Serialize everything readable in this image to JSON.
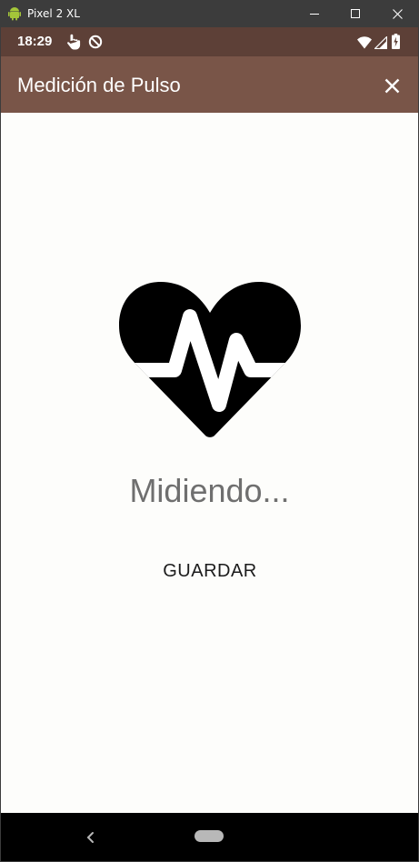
{
  "window": {
    "title": "Pixel 2 XL",
    "controls": [
      "minimize-icon",
      "maximize-icon",
      "close-icon"
    ]
  },
  "status_bar": {
    "time": "18:29",
    "left_icons": [
      "touch-icon",
      "do-not-disturb-icon"
    ],
    "right_icons": [
      "wifi-icon",
      "signal-icon",
      "battery-icon"
    ],
    "color": "#5d4037"
  },
  "app_bar": {
    "title": "Medición de Pulso",
    "close_icon": "close-icon",
    "color": "#795548"
  },
  "main": {
    "icon": "heart-pulse-icon",
    "status": "Midiendo...",
    "save_label": "GUARDAR"
  },
  "nav_bar": {
    "back_icon": "back-chevron-icon",
    "home_icon": "home-pill-icon"
  }
}
